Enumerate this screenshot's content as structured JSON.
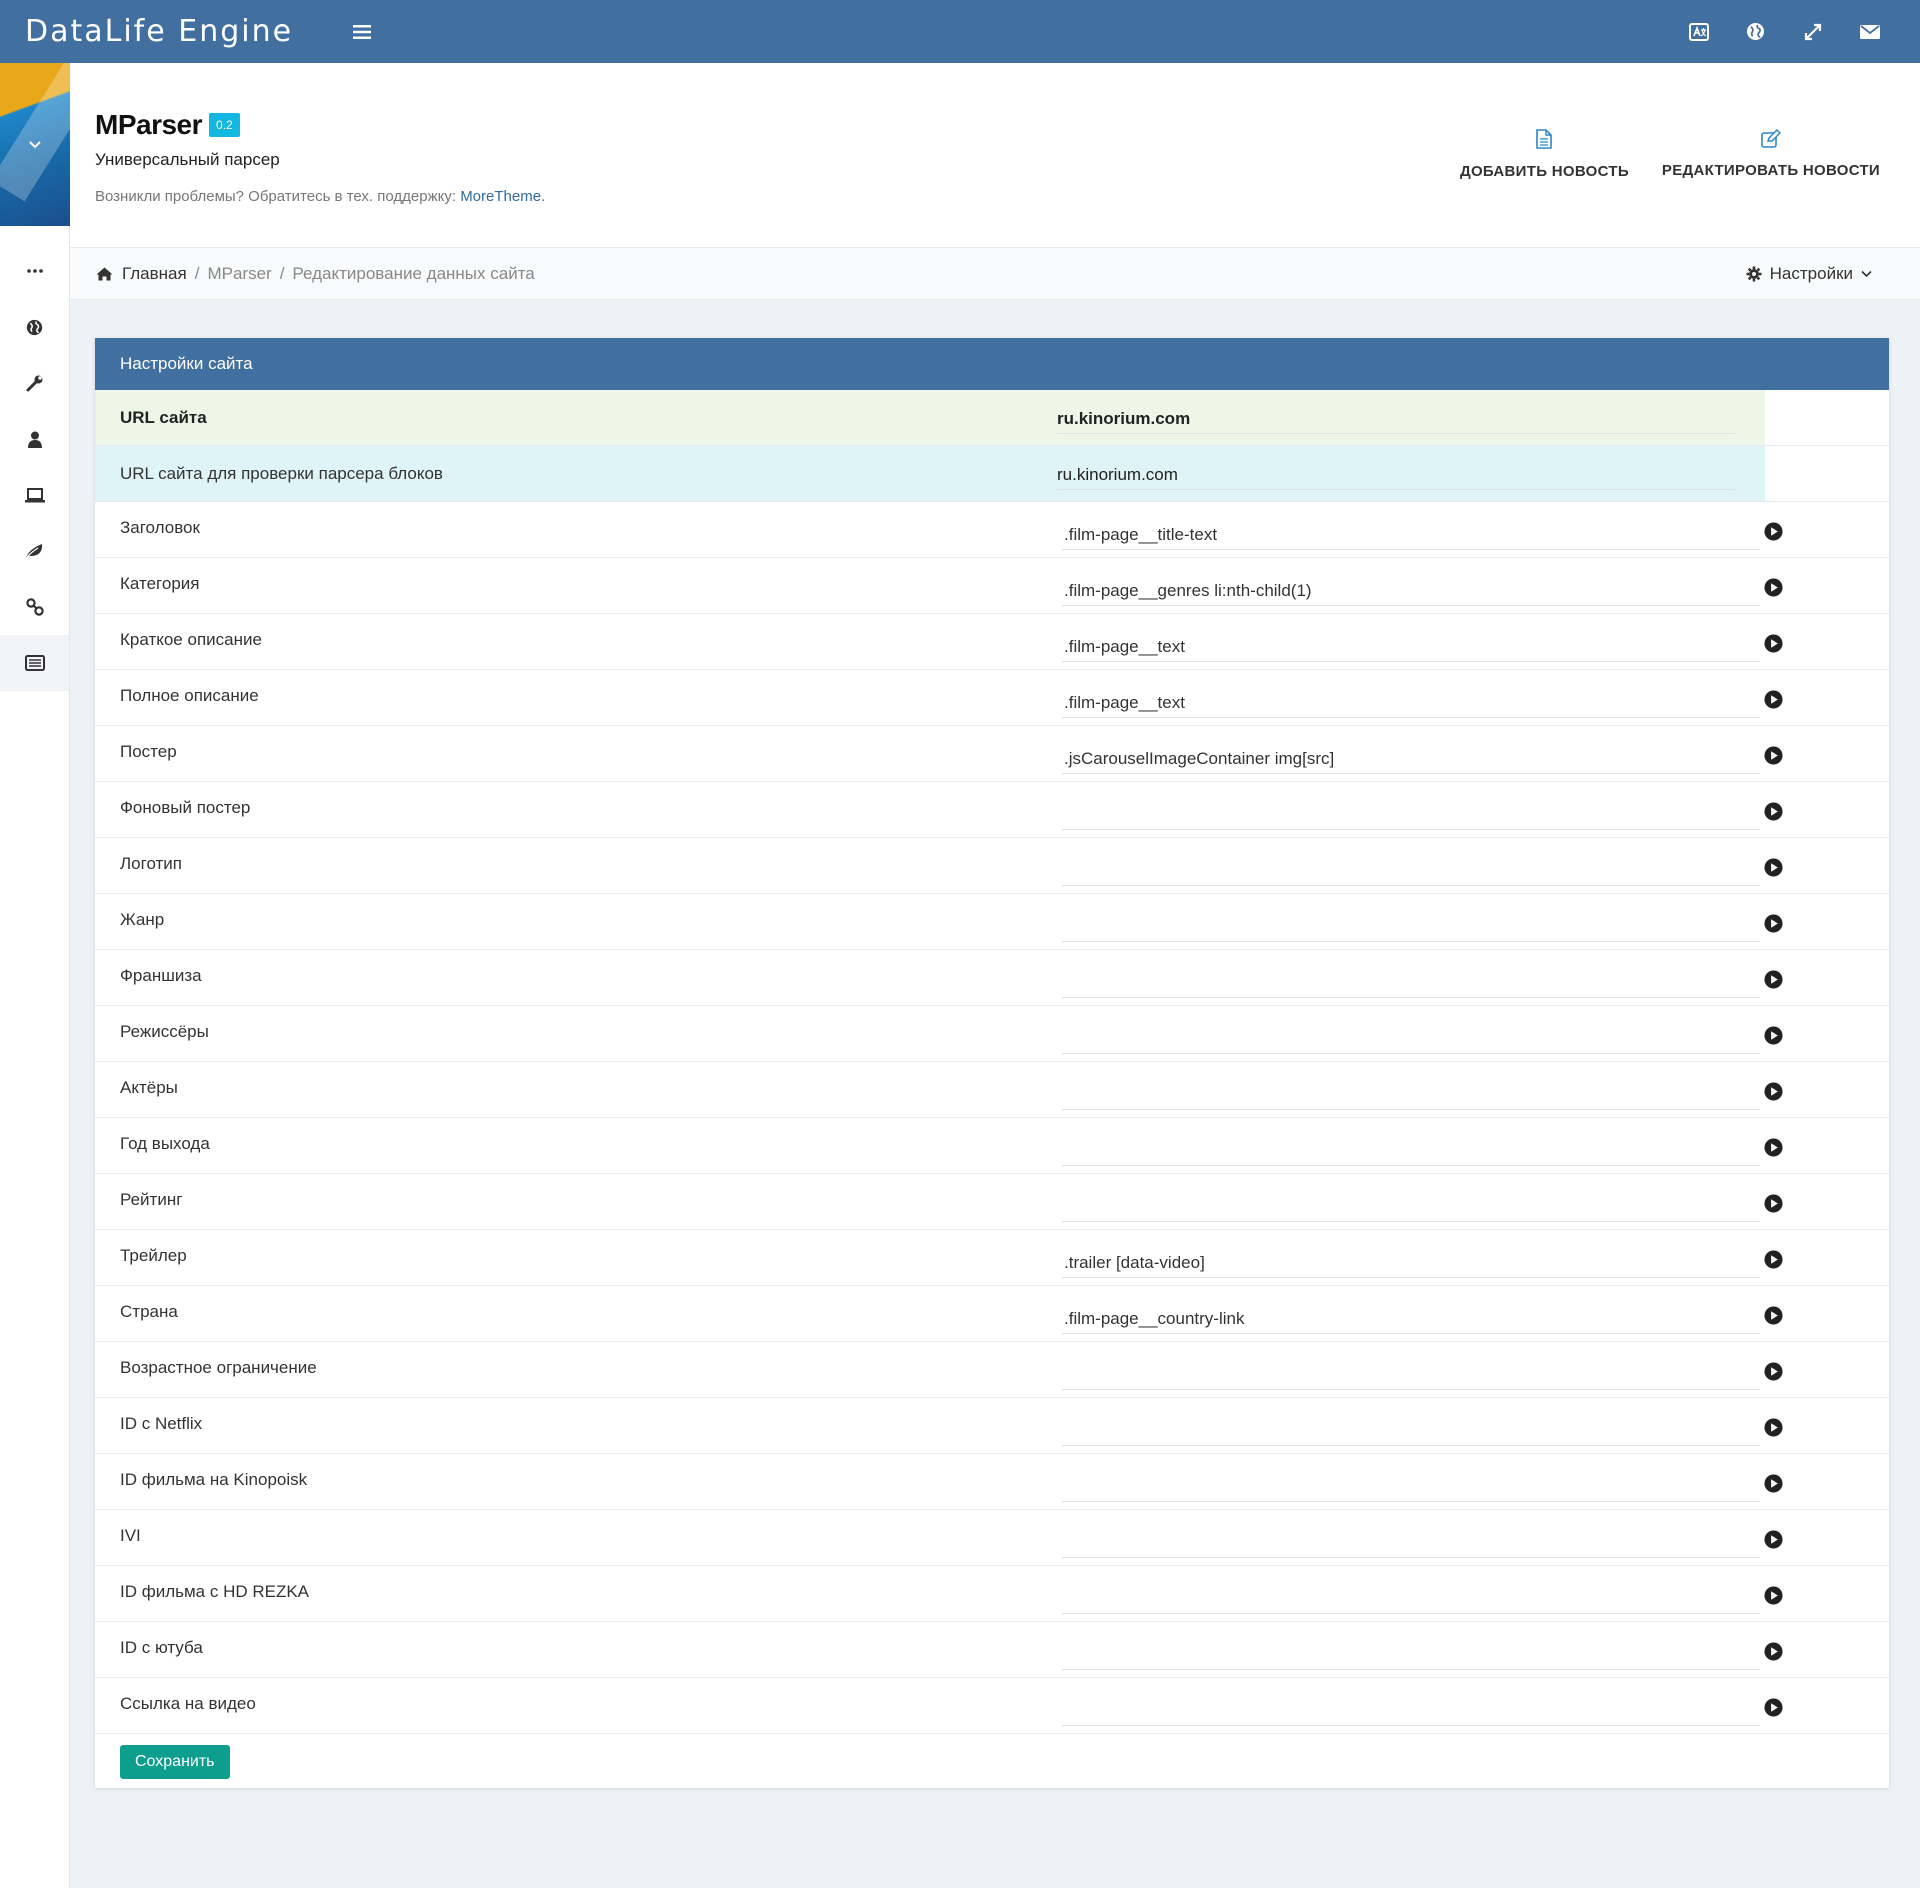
{
  "navbar": {
    "brand": "DataLife Engine",
    "icons": [
      "translate-icon",
      "globe-icon",
      "expand-icon",
      "envelope-icon"
    ]
  },
  "sidebar": {
    "items": [
      "more-icon",
      "globe-icon",
      "wrench-icon",
      "user-icon",
      "laptop-icon",
      "leaf-icon",
      "link-icon",
      "list-icon"
    ],
    "active_index": 7
  },
  "header": {
    "title": "MParser",
    "version": "0.2",
    "subtitle": "Универсальный парсер",
    "help_text": "Возникли проблемы? Обратитесь в тех. поддержку:",
    "help_link": "MoreTheme.",
    "add_news": "ДОБАВИТЬ НОВОСТЬ",
    "edit_news": "РЕДАКТИРОВАТЬ НОВОСТИ"
  },
  "breadcrumb": {
    "home": "Главная",
    "mparser": "MParser",
    "current": "Редактирование данных сайта",
    "settings": "Настройки"
  },
  "card": {
    "title": "Настройки сайта",
    "site_url_label": "URL сайта",
    "site_url_value": "ru.kinorium.com",
    "check_url_label": "URL сайта для проверки парсера блоков",
    "check_url_value": "ru.kinorium.com",
    "fields": [
      {
        "label": "Заголовок",
        "value": ".film-page__title-text"
      },
      {
        "label": "Категория",
        "value": ".film-page__genres li:nth-child(1)"
      },
      {
        "label": "Краткое описание",
        "value": ".film-page__text"
      },
      {
        "label": "Полное описание",
        "value": ".film-page__text"
      },
      {
        "label": "Постер",
        "value": ".jsCarouselImageContainer img[src]"
      },
      {
        "label": "Фоновый постер",
        "value": ""
      },
      {
        "label": "Логотип",
        "value": ""
      },
      {
        "label": "Жанр",
        "value": ""
      },
      {
        "label": "Франшиза",
        "value": ""
      },
      {
        "label": "Режиссёры",
        "value": ""
      },
      {
        "label": "Актёры",
        "value": ""
      },
      {
        "label": "Год выхода",
        "value": ""
      },
      {
        "label": "Рейтинг",
        "value": ""
      },
      {
        "label": "Трейлер",
        "value": ".trailer [data-video]"
      },
      {
        "label": "Страна",
        "value": ".film-page__country-link"
      },
      {
        "label": "Возрастное ограничение",
        "value": ""
      },
      {
        "label": "ID с Netflix",
        "value": ""
      },
      {
        "label": "ID фильма на Kinopoisk",
        "value": ""
      },
      {
        "label": "IVI",
        "value": ""
      },
      {
        "label": "ID фильма с HD REZKA",
        "value": ""
      },
      {
        "label": "ID с ютуба",
        "value": ""
      },
      {
        "label": "Ссылка на видео",
        "value": ""
      }
    ],
    "save_label": "Сохранить"
  },
  "colors": {
    "navbar": "#416f9f",
    "card_head": "#416f9f",
    "save_button": "#0e9e8d",
    "badge": "#13b7e0",
    "row_green": "#edf7e8",
    "row_cyan": "#dff4f7"
  }
}
